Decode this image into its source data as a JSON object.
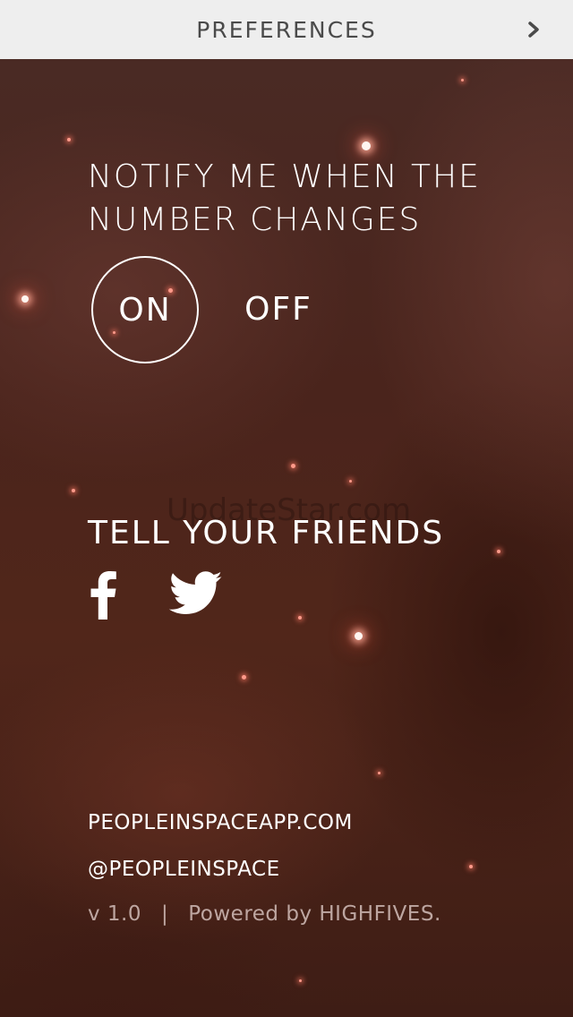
{
  "header": {
    "title": "PREFERENCES",
    "next_icon": "chevron-right-icon"
  },
  "notify": {
    "title_line1": "NOTIFY ME WHEN THE",
    "title_line2": "NUMBER CHANGES",
    "on_label": "ON",
    "off_label": "OFF",
    "selected": "ON"
  },
  "watermark": "UpdateStar.com",
  "share": {
    "title": "TELL YOUR FRIENDS",
    "facebook_icon": "facebook-icon",
    "twitter_icon": "twitter-icon"
  },
  "links": {
    "site": "PEOPLEINSPACEAPP.COM",
    "handle": "@PEOPLEINSPACE"
  },
  "footer": {
    "version": "v 1.0",
    "separator": "|",
    "powered_by": "Powered by HIGHFIVES."
  },
  "colors": {
    "header_bg": "#eeeeee",
    "header_text": "#4a4a4a",
    "text": "#ffffff",
    "background": "#4a241c"
  }
}
